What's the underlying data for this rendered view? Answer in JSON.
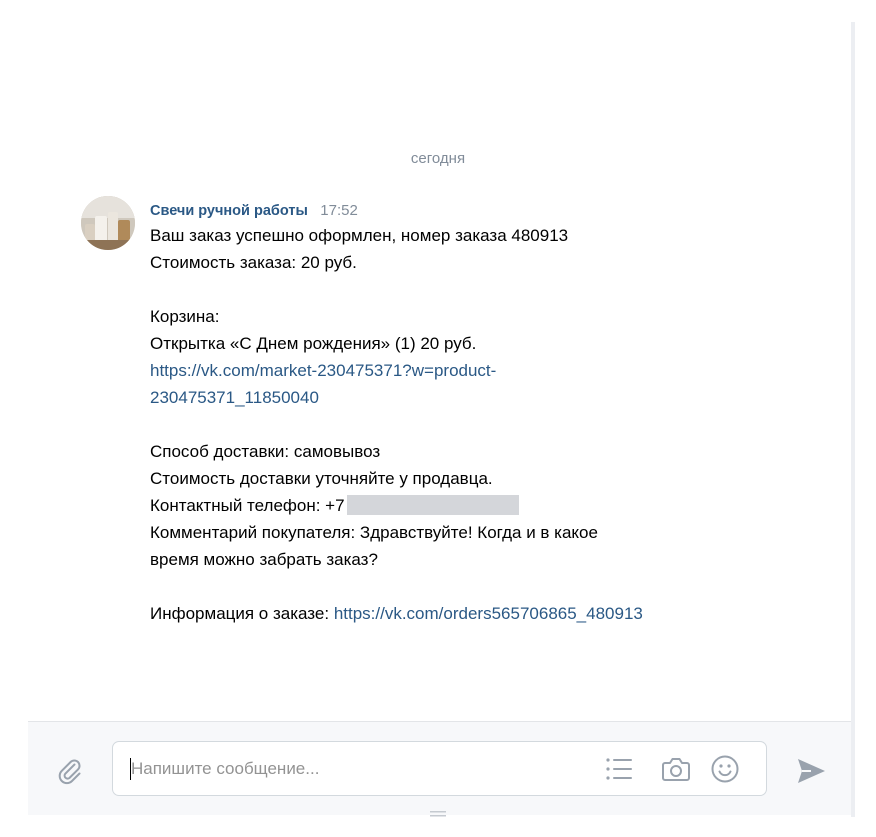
{
  "chat": {
    "date_divider": "сегодня",
    "message": {
      "sender": "Свечи ручной работы",
      "time": "17:52",
      "lines": {
        "l1": "Ваш заказ успешно оформлен, номер заказа 480913",
        "l2": "Стоимость заказа: 20 руб.",
        "l3": "Корзина:",
        "l4": "Открытка «С Днем рождения» (1) 20 руб.",
        "l5_link": "https://vk.com/market-230475371?w=product-",
        "l6_link": "230475371_11850040",
        "l7": "Способ доставки: самовывоз",
        "l8": "Стоимость доставки уточняйте у продавца.",
        "l9_label": "Контактный телефон: +7",
        "l10": "Комментарий покупателя: Здравствуйте! Когда и в какое",
        "l11": "время можно забрать заказ?",
        "l12_label": "Информация о заказе: ",
        "l12_link": "https://vk.com/orders565706865_480913"
      }
    }
  },
  "composer": {
    "placeholder": "Напишите сообщение...",
    "icons": {
      "attach": "paperclip-icon",
      "templates": "list-icon",
      "camera": "camera-icon",
      "emoji": "smile-icon",
      "send": "send-icon"
    }
  },
  "colors": {
    "link": "#2a5885",
    "muted": "#818c99",
    "icon": "#99a2ad",
    "composer_bg": "#f7f8fa"
  }
}
